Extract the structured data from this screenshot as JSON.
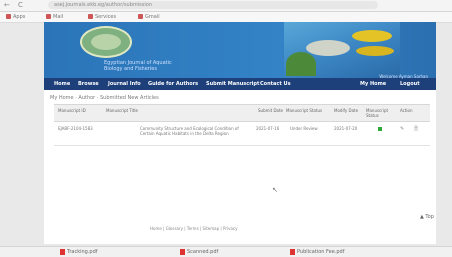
{
  "browser": {
    "url": "asej.journals.ekb.eg/author/submission",
    "nav_back": "←",
    "nav_reload": "C",
    "bookmarks": [
      "Apps",
      "Mail",
      "Services",
      "Gmail"
    ]
  },
  "journal": {
    "title_line1": "Egyptian Journal of Aquatic",
    "title_line2": "Biology and Fisheries"
  },
  "navbar": {
    "items": [
      "Home",
      "Browse",
      "Journal Info",
      "Guide for Authors",
      "Submit Manuscript",
      "Contact Us"
    ],
    "welcome": "Welcome Ayman Sarhan",
    "my_home": "My Home",
    "logout": "Logout"
  },
  "breadcrumb": "My Home · Author · Submitted New Articles",
  "table": {
    "headers": [
      "Manuscript ID",
      "Manuscript Title",
      "Submit Date",
      "Manuscript Status",
      "Modify Date",
      "Manuscript Status",
      "Action"
    ],
    "rows": [
      {
        "id": "EJABF-2104-1583",
        "title": "Community Structure and Ecological Condition of Certain Aquatic Habitats in the Delta Region",
        "submit_date": "2021-07-16",
        "status": "Under Review",
        "modify_date": "2021-07-20"
      }
    ],
    "action_glyphs": [
      "✎",
      "🗎"
    ]
  },
  "footer": "Home | Glossary | Terms | Sitemap | Privacy",
  "page_indicator": "▲ Top",
  "downloads": [
    "Tracking.pdf",
    "Scanned.pdf",
    "Publication Fee.pdf"
  ]
}
